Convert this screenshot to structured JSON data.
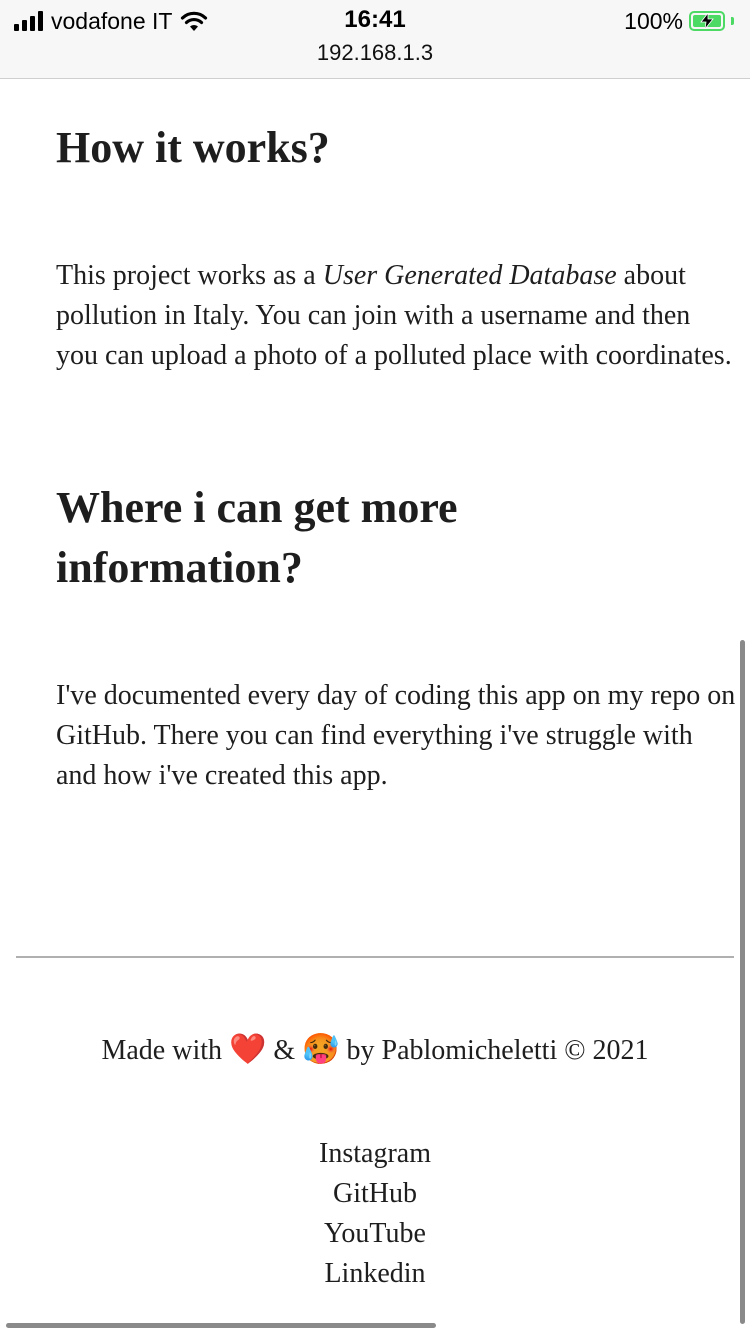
{
  "status_bar": {
    "carrier": "vodafone IT",
    "time": "16:41",
    "url": "192.168.1.3",
    "battery_percent": "100%",
    "wifi_icon": "wifi-icon",
    "signal_icon": "signal-icon",
    "battery_icon": "battery-charging-icon"
  },
  "sections": {
    "how": {
      "title": "How it works?",
      "text_before": "This project works as a ",
      "text_em": "User Generated Database",
      "text_after": " about pollution in Italy. You can join with a username and then you can upload a photo of a polluted place with coordinates."
    },
    "where": {
      "title": "Where i can get more information?",
      "text": "I've documented every day of coding this app on my repo on GitHub. There you can find everything i've struggle with and how i've created this app."
    }
  },
  "footer": {
    "made_with": "Made with",
    "heart": "❤️",
    "amp": "&",
    "hot_face": "🥵",
    "credit": "by Pablomicheletti © 2021",
    "links": [
      "Instagram",
      "GitHub",
      "YouTube",
      "Linkedin"
    ]
  },
  "colors": {
    "battery": "#4cd964",
    "text": "#1e1e1e",
    "statusbar_bg": "#f7f7f7"
  }
}
